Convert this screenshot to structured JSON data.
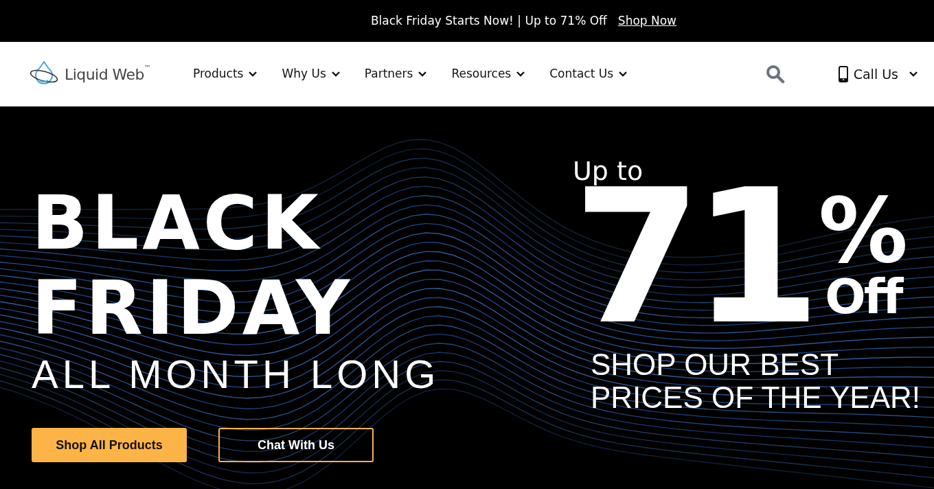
{
  "promo_bar": {
    "text": "Black Friday Starts Now! | Up to 71% Off",
    "link": "Shop Now"
  },
  "header": {
    "logo": {
      "text": "Liquid Web",
      "mark": "™"
    },
    "nav": [
      {
        "label": "Products"
      },
      {
        "label": "Why Us"
      },
      {
        "label": "Partners"
      },
      {
        "label": "Resources"
      },
      {
        "label": "Contact Us"
      }
    ],
    "call": {
      "label": "Call Us"
    }
  },
  "hero": {
    "headline_lines": [
      "BLACK",
      "FRIDAY"
    ],
    "subheadline": "ALL MONTH LONG",
    "buttons": [
      {
        "label": "Shop All Products",
        "kind": "primary"
      },
      {
        "label": "Chat With Us",
        "kind": "outline"
      }
    ],
    "offer": {
      "prefix": "Up to",
      "number": "71",
      "percent": "%",
      "suffix": "Off",
      "tagline_lines": [
        "SHOP OUR BEST",
        "PRICES OF THE YEAR!"
      ]
    }
  }
}
